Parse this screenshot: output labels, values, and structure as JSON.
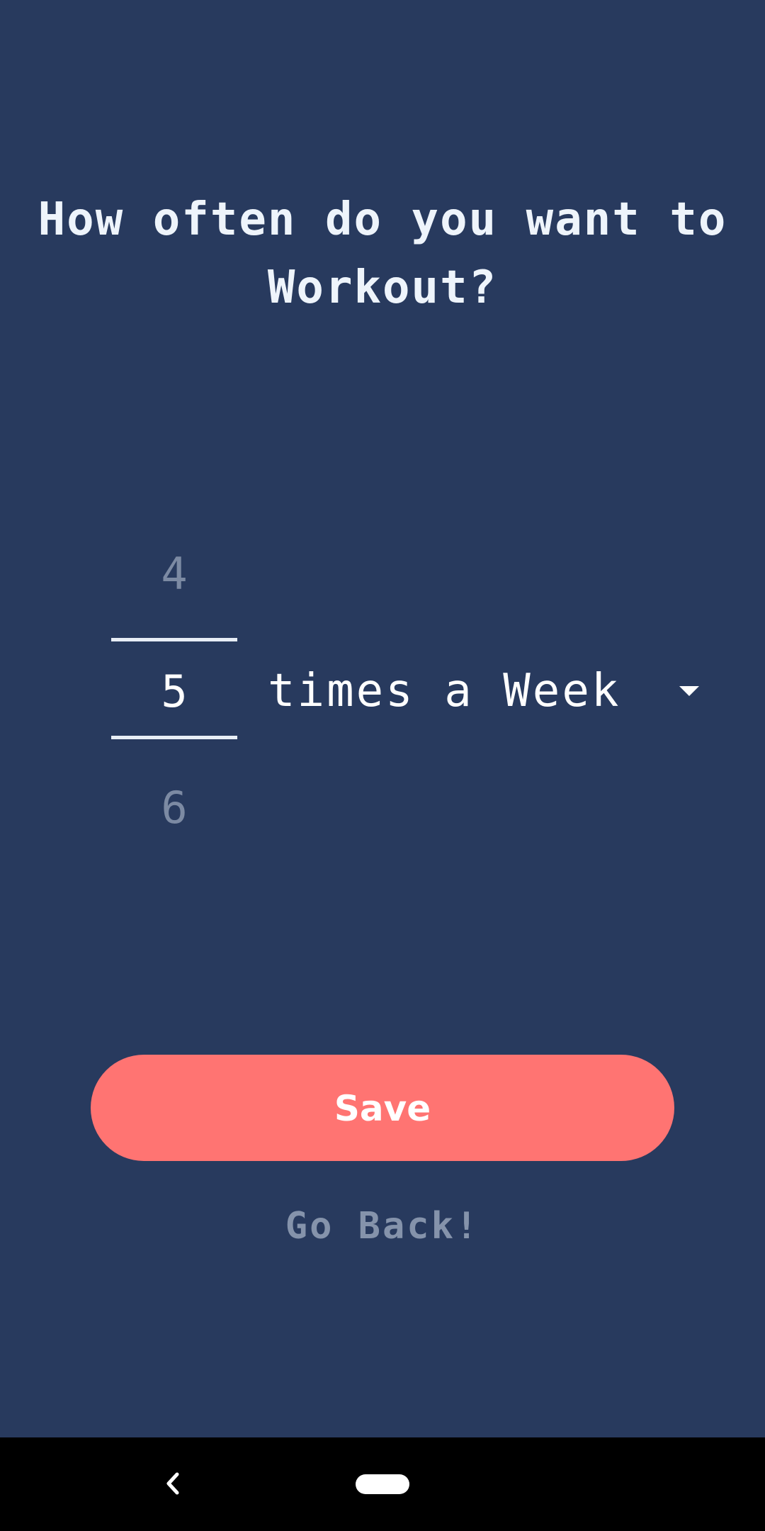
{
  "screen": {
    "title": "How often do you want to Workout?"
  },
  "picker": {
    "previous_value": "4",
    "current_value": "5",
    "next_value": "6"
  },
  "frequency_select": {
    "selected_label": "times a Week"
  },
  "actions": {
    "save_label": "Save",
    "go_back_label": "Go Back!"
  },
  "colors": {
    "background": "#283a5e",
    "accent": "#ff7472",
    "muted_text": "#8593ab",
    "primary_text": "#eef4fb"
  },
  "navigation_bar": {
    "back_icon": "chevron-left-icon",
    "home_icon": "home-pill-icon"
  }
}
